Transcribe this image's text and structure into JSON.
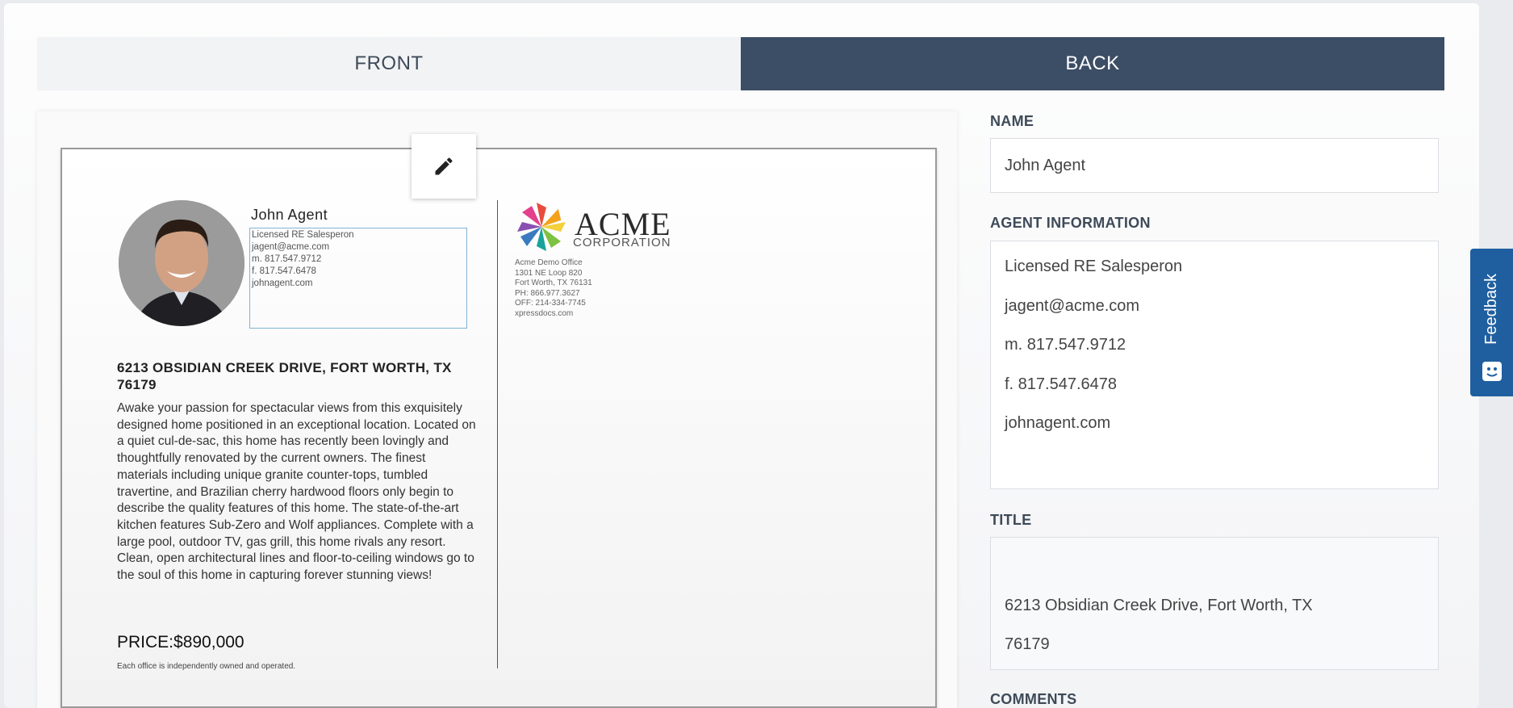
{
  "tabs": {
    "front": "FRONT",
    "back": "BACK"
  },
  "card": {
    "agent_name": "John Agent",
    "agent_info_lines": [
      "Licensed RE Salesperon",
      "jagent@acme.com",
      "m. 817.547.9712",
      "f. 817.547.6478",
      "johnagent.com"
    ],
    "logo_word": "ACME",
    "logo_sub": "CORPORATION",
    "office_lines": [
      "Acme Demo Office",
      "1301 NE Loop 820",
      "Fort Worth, TX 76131",
      "PH: 866.977.3627",
      "OFF: 214-334-7745",
      "xpressdocs.com"
    ],
    "property_title": "6213 OBSIDIAN CREEK DRIVE, FORT WORTH, TX 76179",
    "property_description": "Awake your passion for spectacular views from this exquisitely designed home positioned in an exceptional location.  Located on a quiet cul-de-sac, this home has recently been lovingly and thoughtfully renovated by the current owners.  The finest materials including unique granite counter-tops, tumbled travertine, and Brazilian cherry hardwood floors only begin to describe the quality features of this home.  The state-of-the-art kitchen features Sub-Zero and Wolf appliances. Complete with a large pool, outdoor TV, gas grill, this home rivals any resort.  Clean, open architectural lines and floor-to-ceiling windows go to the soul of this home in capturing forever stunning views!",
    "price": "PRICE:$890,000",
    "disclaimer": "Each office is independently owned and operated."
  },
  "form": {
    "name_label": "NAME",
    "name_value": "John Agent",
    "agent_info_label": "AGENT INFORMATION",
    "agent_info_lines": [
      "Licensed RE Salesperon",
      "jagent@acme.com",
      "m. 817.547.9712",
      "f. 817.547.6478",
      "johnagent.com"
    ],
    "title_label": "TITLE",
    "title_lines": [
      "6213 Obsidian Creek Drive, Fort Worth, TX",
      "76179"
    ],
    "comments_label": "COMMENTS"
  },
  "feedback": {
    "label": "Feedback"
  },
  "colors": {
    "tab_active": "#3c4d66",
    "tab_inactive": "#f2f3f5",
    "feedback": "#1f5fa0",
    "selection_border": "#7fb3d5"
  },
  "icons": {
    "edit": "pencil-icon",
    "feedback": "smiley-icon",
    "logo": "pinwheel-logo-icon"
  }
}
